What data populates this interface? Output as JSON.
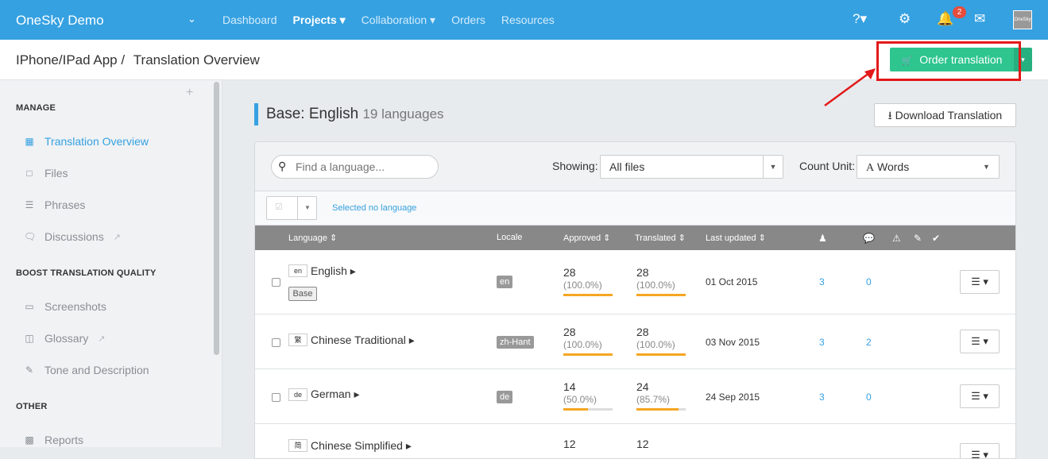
{
  "topbar": {
    "brand": "OneSky Demo",
    "nav": [
      "Dashboard",
      "Projects ▾",
      "Collaboration ▾",
      "Orders",
      "Resources"
    ],
    "notification_count": "2",
    "avatar_text": "OneSky"
  },
  "breadcrumb": {
    "project": "IPhone/IPad App /",
    "page": "Translation Overview"
  },
  "order_button": "Order translation",
  "sidebar": {
    "sections": [
      {
        "title": "MANAGE",
        "items": [
          "Translation Overview",
          "Files",
          "Phrases",
          "Discussions"
        ]
      },
      {
        "title": "BOOST TRANSLATION QUALITY",
        "items": [
          "Screenshots",
          "Glossary",
          "Tone and Description"
        ]
      },
      {
        "title": "OTHER",
        "items": [
          "Reports"
        ]
      }
    ]
  },
  "panel": {
    "title": "Base: English",
    "subtitle": "19 languages",
    "download_button": "Download Translation"
  },
  "filters": {
    "search_placeholder": "Find a language...",
    "showing_label": "Showing:",
    "showing_value": "All files",
    "count_label": "Count Unit:",
    "count_value": "Words"
  },
  "selection_text": "Selected no language",
  "table": {
    "headers": [
      "Language ⇕",
      "Locale",
      "Approved ⇕",
      "Translated ⇕",
      "Last updated ⇕"
    ],
    "rows": [
      {
        "flag": "en",
        "name": "English",
        "base": "Base",
        "locale": "en",
        "approved": "28",
        "approved_pct": "(100.0%)",
        "approved_frac": 1.0,
        "translated": "28",
        "translated_pct": "(100.0%)",
        "translated_frac": 1.0,
        "updated": "01 Oct 2015",
        "users": "3",
        "comments": "0"
      },
      {
        "flag": "繁",
        "name": "Chinese Traditional",
        "locale": "zh-Hant",
        "approved": "28",
        "approved_pct": "(100.0%)",
        "approved_frac": 1.0,
        "translated": "28",
        "translated_pct": "(100.0%)",
        "translated_frac": 1.0,
        "updated": "03 Nov 2015",
        "users": "3",
        "comments": "2"
      },
      {
        "flag": "de",
        "name": "German",
        "locale": "de",
        "approved": "14",
        "approved_pct": "(50.0%)",
        "approved_frac": 0.5,
        "translated": "24",
        "translated_pct": "(85.7%)",
        "translated_frac": 0.857,
        "updated": "24 Sep 2015",
        "users": "3",
        "comments": "0"
      },
      {
        "flag": "简",
        "name": "Chinese Simplified",
        "approved": "12",
        "translated": "12"
      }
    ]
  },
  "colors": {
    "topbar": "#35a1e1",
    "order_button": "#2ec58f",
    "highlight": "#e21a1a",
    "progress": "#f5a623"
  }
}
